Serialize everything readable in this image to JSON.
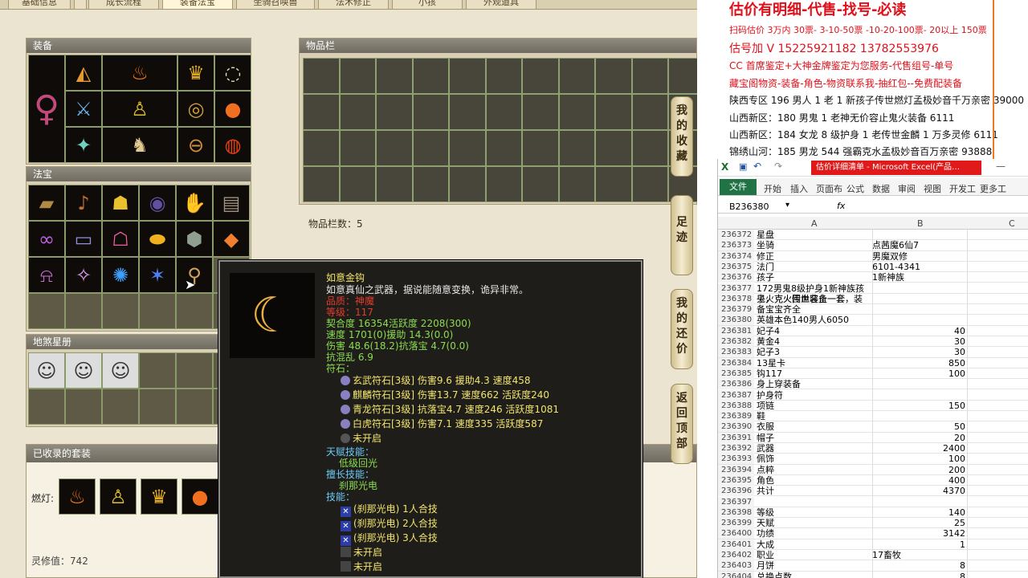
{
  "tabs": [
    "基础信息",
    "成长流程",
    "装备法宝",
    "坐骑召唤兽",
    "法术修正",
    "小孩",
    "外观道具"
  ],
  "equip": {
    "title": "装备",
    "icons": [
      "cape-icon",
      "flame-crown-icon",
      "character-portrait",
      "gold-helm-icon",
      "necklace-icon",
      "blade-icon",
      "robe-icon",
      "ring-icon",
      "pendant-icon",
      "fan-icon",
      "boots-icon",
      "belt-icon",
      "fireball-icon"
    ]
  },
  "fabao": {
    "title": "法宝",
    "icons": [
      "token-icon",
      "lute-icon",
      "lantern-icon",
      "dark-orb-icon",
      "claw-icon",
      "box-icon",
      "ribbon-icon",
      "scroll-icon",
      "pink-lantern-icon",
      "gold-ingot-icon",
      "shield-icon",
      "gem-icon",
      "bell-icon",
      "bird-icon",
      "blue-orb-icon",
      "spark-icon",
      "hook-icon"
    ]
  },
  "dishastar": {
    "title": "地煞星册",
    "portraits": [
      "warrior-portrait",
      "sage-portrait",
      "swordsman-portrait"
    ]
  },
  "inventory": {
    "title": "物品栏",
    "count_label": "物品栏数：5"
  },
  "collected": {
    "title": "已收录的套装",
    "label": "燃灯:",
    "lingxiu": "灵修值：742"
  },
  "side_buttons": [
    {
      "label": [
        "我",
        "的",
        "收",
        "藏"
      ]
    },
    {
      "label": [
        "足",
        "迹"
      ]
    },
    {
      "label": [
        "我",
        "的",
        "还",
        "价"
      ]
    },
    {
      "label": [
        "返",
        "回",
        "顶",
        "部"
      ]
    }
  ],
  "tooltip": {
    "name": "如意金钩",
    "desc": "如意真仙之武器，据说能随意变换，诡异非常。",
    "quality": "品质：神魔",
    "level": "等级：117",
    "stats": [
      "契合度   16354活跃度   2208(300)",
      "速度     1701(0)援助    14.3(0.0)",
      "伤害     48.6(18.2)抗落宝    4.7(0.0)",
      "抗混乱 6.9"
    ],
    "rune_header": "符石：",
    "runes": [
      "玄武符石[3级] 伤害9.6 援助4.3 速度458",
      "麒麟符石[3级] 伤害13.7 速度662 活跃度240",
      "青龙符石[3级] 抗落宝4.7 速度246 活跃度1081",
      "白虎符石[3级] 伤害7.1 速度335 活跃度587",
      "未开启"
    ],
    "talent_header": "天赋技能：",
    "talent": "低级回光",
    "special_header": "擅长技能：",
    "special": "刹那光电",
    "skill_header": "技能：",
    "skills": [
      "(刹那光电) 1人合技",
      "(刹那光电) 2人合技",
      "(刹那光电) 3人合技",
      "未开启",
      "未开启"
    ]
  },
  "overlay": {
    "headline": "估价有明细-代售-找号-必读",
    "lines": [
      "扫码估价 3万内 30票- 3-10-50票 -10-20-100票- 20以上 150票",
      "估号加 V 15225921182   13782553976",
      "CC 首席鉴定+大神金牌鉴定为您服务-代售组号-单号",
      "藏宝阁物资-装备-角色-物资联系我-抽红包--免费配装备",
      "陕西专区 196 男人 1 老 1 新孩子传世燃灯孟极妙音千万亲密 39000",
      "山西新区：180 男鬼 1 老神无价容止鬼火装备 6111",
      "山西新区：184 女龙 8 级护身 1 老传世金麟 1 万多灵修 6111",
      "锦绣山河：185 男龙 544 强霸克水孟极妙音百万亲密 93888"
    ]
  },
  "excel": {
    "title": "估价详细清单 - Microsoft Excel(产品…",
    "ribbon": [
      "文件",
      "开始",
      "插入",
      "页面布",
      "公式",
      "数据",
      "审阅",
      "视图",
      "开发工",
      "更多工"
    ],
    "cell_ref": "B236380",
    "fx": "fx",
    "col_headers": [
      "A",
      "B",
      "C"
    ],
    "rows": [
      [
        "236372",
        "星盘",
        ""
      ],
      [
        "236373",
        "坐骑",
        "点茜魔6仙7"
      ],
      [
        "236374",
        "修正",
        "男魔双修"
      ],
      [
        "236375",
        "法门",
        "6101-4341"
      ],
      [
        "236376",
        "孩子",
        "1新神族"
      ],
      [
        "236377",
        "172男鬼8级护身1新神族孩子，克火回血装备一套",
        ""
      ],
      [
        "236378",
        "鬼火克火传世容止一套，装备宝宝齐全",
        ""
      ],
      [
        "236379",
        "",
        ""
      ],
      [
        "236380",
        "英雄本色140男人6050",
        ""
      ],
      [
        "236381",
        "妃子4",
        "40"
      ],
      [
        "236382",
        "黄金4",
        "30"
      ],
      [
        "236383",
        "妃子3",
        "30"
      ],
      [
        "236384",
        "13星卡",
        "850"
      ],
      [
        "236385",
        "钩117",
        "100"
      ],
      [
        "236386",
        "身上穿装备",
        ""
      ],
      [
        "236387",
        "护身符",
        ""
      ],
      [
        "236388",
        "项链",
        "150"
      ],
      [
        "236389",
        "鞋",
        ""
      ],
      [
        "236390",
        "衣服",
        "50"
      ],
      [
        "236391",
        "帽子",
        "20"
      ],
      [
        "236392",
        "武器",
        "2400"
      ],
      [
        "236393",
        "佩饰",
        "100"
      ],
      [
        "236394",
        "点粹",
        "200"
      ],
      [
        "236395",
        "角色",
        "400"
      ],
      [
        "236396",
        "共计",
        "4370"
      ],
      [
        "236397",
        "",
        ""
      ],
      [
        "236398",
        "等级",
        "140"
      ],
      [
        "236399",
        "天赋",
        "25"
      ],
      [
        "236400",
        "功绩",
        "3142"
      ],
      [
        "236401",
        "大成",
        "1"
      ],
      [
        "236402",
        "职业",
        "17畜牧"
      ],
      [
        "236403",
        "月饼",
        "8"
      ],
      [
        "236404",
        "总换点数",
        "8"
      ]
    ]
  }
}
